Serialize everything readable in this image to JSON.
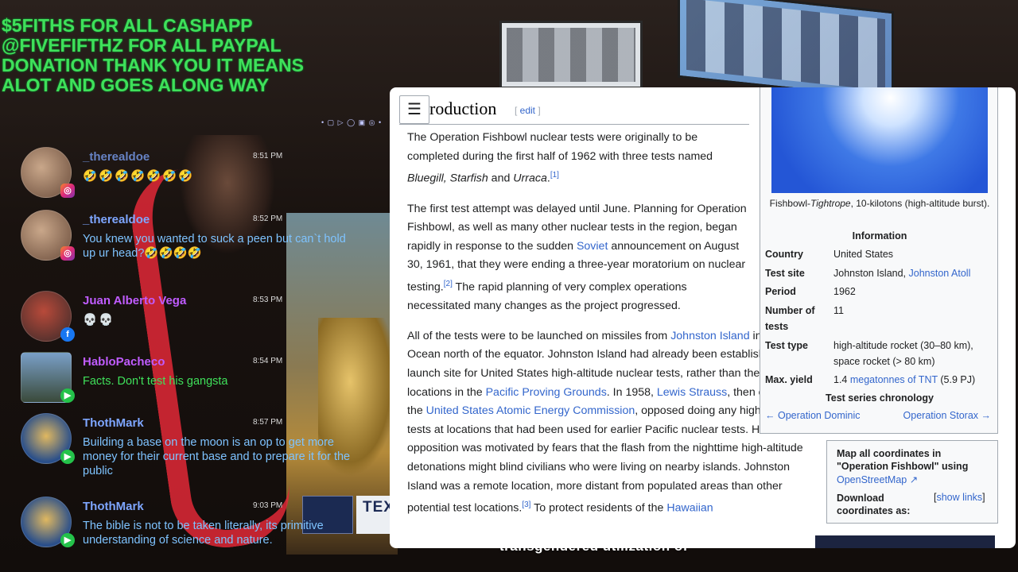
{
  "donation": {
    "text": "$5FITHS FOR ALL CASHAPP\n@FIVEFIFTHZ FOR ALL PAYPAL\n DONATION THANK YOU IT MEANS\nALOT  AND GOES ALONG WAY"
  },
  "background": {
    "caption": "transgendered utilization of",
    "tex_label": "TEX"
  },
  "chat": {
    "messages": [
      {
        "name": "_therealdoe",
        "time": "8:51 PM",
        "text": "🤣🤣🤣🤣🤣🤣🤣",
        "platform": "instagram",
        "name_color": "#7ea6ff"
      },
      {
        "name": "_therealdoe",
        "time": "8:52 PM",
        "text": "You knew you wanted to suck a peen but can`t hold up ur head?🤣🤣🤣🤣",
        "platform": "instagram",
        "name_color": "#7ea6ff"
      },
      {
        "name": "Juan Alberto Vega",
        "time": "8:53 PM",
        "text": "💀💀",
        "platform": "facebook",
        "name_color": "#c05cff"
      },
      {
        "name": "HabloPacheco",
        "time": "8:54 PM",
        "text": "Facts. Don't test his gangsta",
        "platform": "youtube",
        "name_color": "#c05cff"
      },
      {
        "name": "ThothMark",
        "time": "8:57 PM",
        "text": "Building a base on the moon is an op to get more money for their current base and to prepare it for the public",
        "platform": "youtube",
        "name_color": "#c05cff"
      },
      {
        "name": "ThothMark",
        "time": "9:03 PM",
        "text": "The bible is not to be taken literally, its primitive understanding of science and nature.",
        "platform": "youtube",
        "name_color": "#c05cff"
      }
    ]
  },
  "wiki": {
    "heading": "roduction",
    "edit_label": "edit",
    "p1_text": "The Operation Fishbowl nuclear tests were originally to be completed during the first half of 1962 with three tests named ",
    "p1_italic": "Bluegill, Starfish",
    "p1_and": " and ",
    "p1_italic2": "Urraca",
    "p1_end": ".",
    "p1_ref": "[1]",
    "p2_a": "The first test attempt was delayed until June. Planning for Operation Fishbowl, as well as many other nuclear tests in the region, began rapidly in response to the sudden ",
    "p2_soviet": "Soviet",
    "p2_b": " announcement on August 30, 1961, that they were ending a three-year moratorium on nuclear testing.",
    "p2_ref": "[2]",
    "p2_c": " The rapid planning of very complex operations necessitated many changes as the project progressed.",
    "p3_a": "All of the tests were to be launched on missiles from ",
    "p3_johnston": "Johnston Island",
    "p3_b": " in the Pacific Ocean north of the equator. Johnston Island had already been established as a launch site for United States high-altitude nuclear tests, rather than the other locations in the ",
    "p3_ppg": "Pacific Proving Grounds",
    "p3_c": ". In 1958, ",
    "p3_strauss": "Lewis Strauss",
    "p3_d": ", then chairman of the ",
    "p3_aec": "United States Atomic Energy Commission",
    "p3_e": ", opposed doing any high-altitude tests at locations that had been used for earlier Pacific nuclear tests. His opposition was motivated by fears that the flash from the nighttime high-altitude detonations might blind civilians who were living on nearby islands. Johnston Island was a remote location, more distant from populated areas than other potential test locations.",
    "p3_ref": "[3]",
    "p3_f": " To protect residents of the ",
    "p3_hawaiian": "Hawaiian"
  },
  "infobox": {
    "caption_a": "Fishbowl-",
    "caption_italic": "Tightrope",
    "caption_b": ", 10-kilotons (high-altitude burst).",
    "info_header": "Information",
    "country_k": "Country",
    "country_v": "United States",
    "site_k": "Test site",
    "site_v1": "Johnston Island, ",
    "site_v2": "Johnston Atoll",
    "period_k": "Period",
    "period_v": "1962",
    "num_k": "Number of tests",
    "num_v": "11",
    "type_k": "Test type",
    "type_v": "high-altitude rocket (30–80 km), space rocket (> 80 km)",
    "yield_k": "Max. yield",
    "yield_v1": "1.4 ",
    "yield_link": "megatonnes of TNT",
    "yield_v2": " (5.9 PJ)",
    "chrono_header": "Test series chronology",
    "prev": "← Operation Dominic",
    "next": "Operation Storax →"
  },
  "coords": {
    "title": "Map all coordinates in \"Operation Fishbowl\" using",
    "osm": "OpenStreetMap ↗",
    "download": "Download coordinates as:",
    "show_open": "[",
    "show_links": "show links",
    "show_close": "]"
  }
}
